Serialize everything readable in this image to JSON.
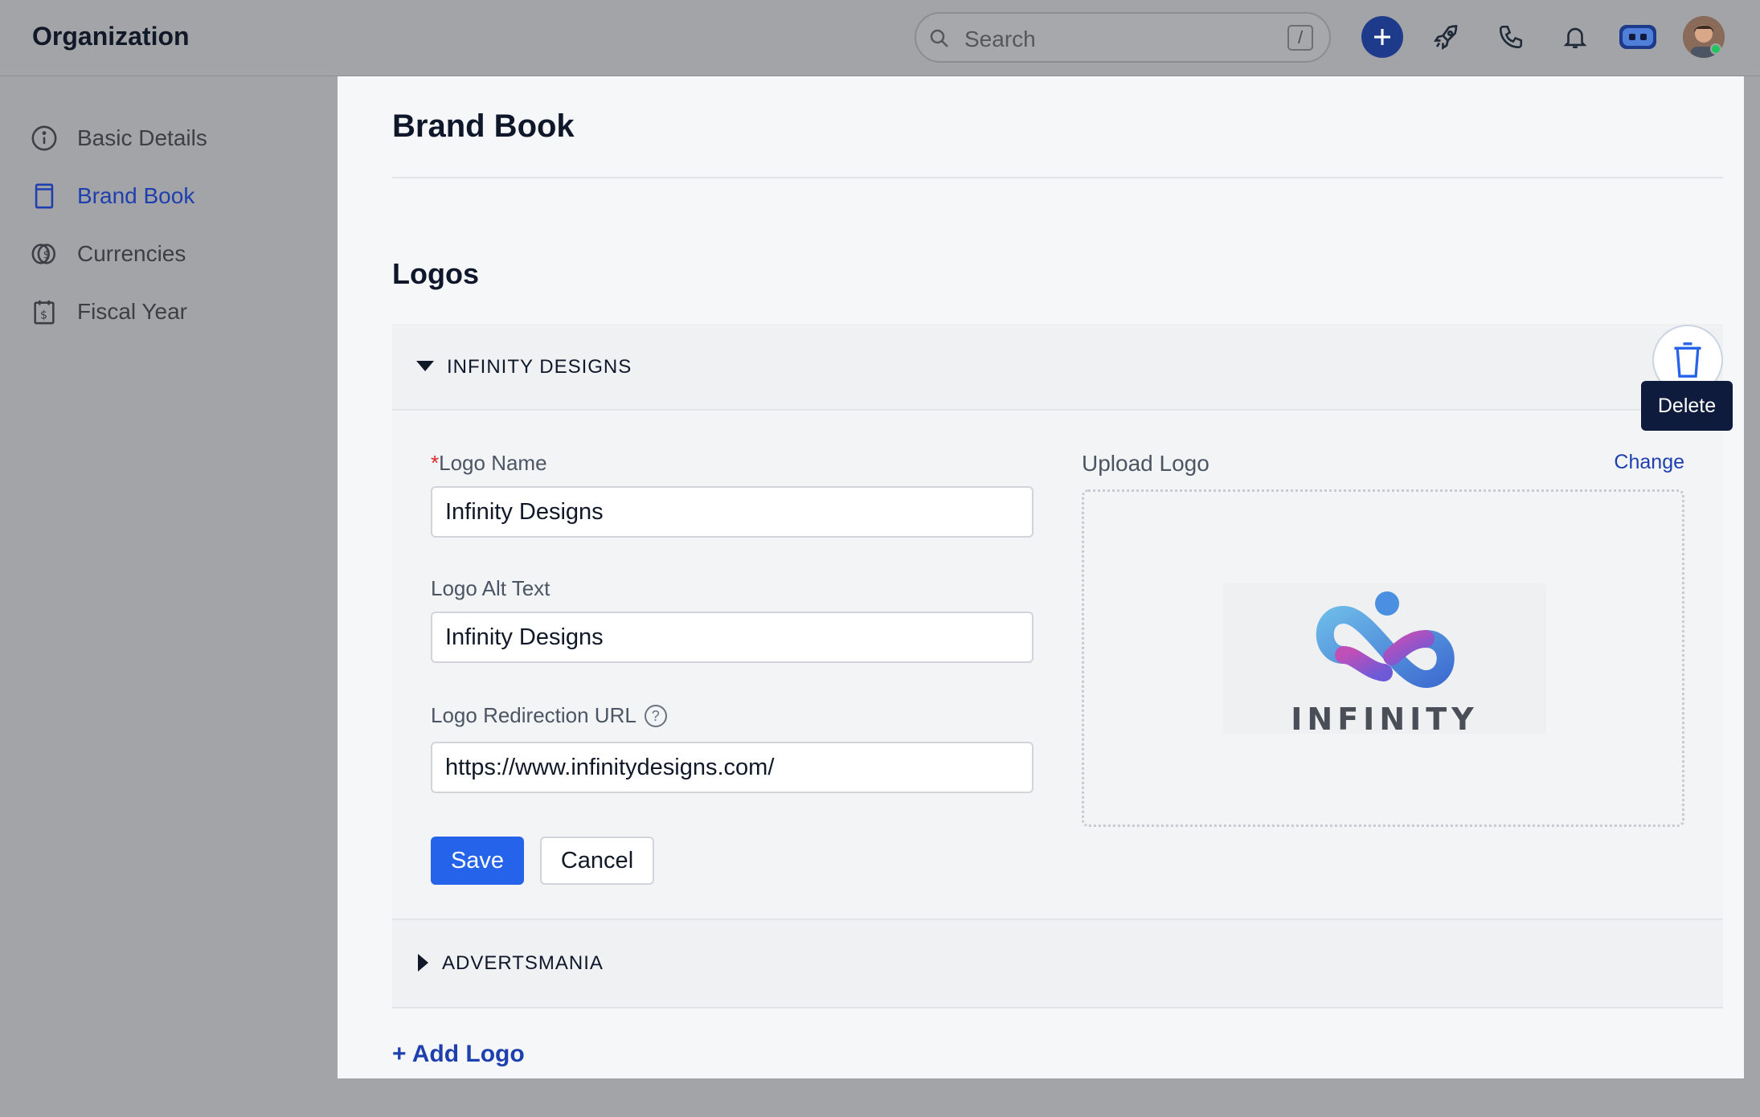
{
  "header": {
    "title": "Organization",
    "search_placeholder": "Search",
    "search_shortcut": "/"
  },
  "sidebar": {
    "items": [
      {
        "label": "Basic Details",
        "icon": "info-icon",
        "active": false
      },
      {
        "label": "Brand Book",
        "icon": "book-icon",
        "active": true
      },
      {
        "label": "Currencies",
        "icon": "coin-icon",
        "active": false
      },
      {
        "label": "Fiscal Year",
        "icon": "calendar-dollar-icon",
        "active": false
      }
    ]
  },
  "main": {
    "page_title": "Brand Book",
    "section_title": "Logos",
    "logos": [
      {
        "name": "INFINITY DESIGNS",
        "expanded": true,
        "fields": {
          "logo_name_label": "Logo Name",
          "logo_name_required": "*",
          "logo_name_value": "Infinity Designs",
          "alt_text_label": "Logo Alt Text",
          "alt_text_value": "Infinity Designs",
          "url_label": "Logo Redirection URL",
          "url_help": "?",
          "url_value": "https://www.infinitydesigns.com/"
        },
        "upload_label": "Upload Logo",
        "change_label": "Change",
        "logo_preview_text": "INFINITY",
        "save_label": "Save",
        "cancel_label": "Cancel"
      },
      {
        "name": "ADVERTSMANIA",
        "expanded": false
      }
    ],
    "delete_tooltip": "Delete",
    "add_logo_label": "+ Add Logo"
  },
  "colors": {
    "accent": "#2563eb",
    "link": "#1e40af",
    "tooltip_bg": "#0f1b3d",
    "overlay": "#a3a4a7"
  }
}
